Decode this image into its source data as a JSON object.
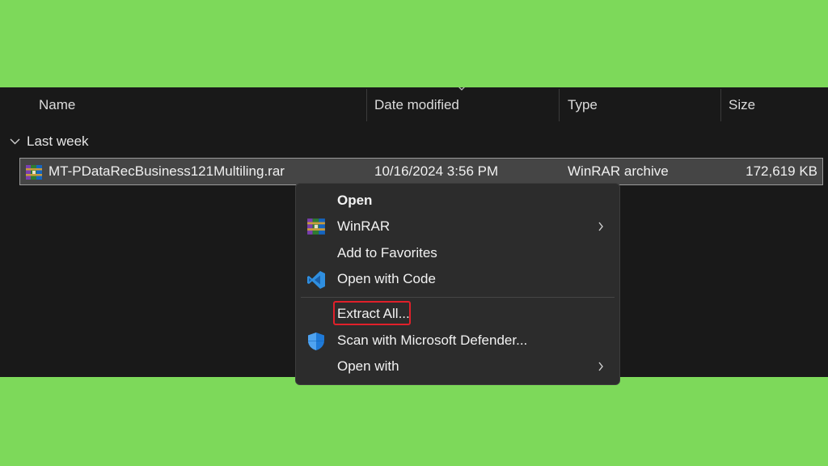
{
  "columns": {
    "name": "Name",
    "date_modified": "Date modified",
    "type": "Type",
    "size": "Size"
  },
  "group": {
    "label": "Last week",
    "icon": "chevron-down-icon"
  },
  "file": {
    "name": "MT-PDataRecBusiness121Multiling.rar",
    "date_modified": "10/16/2024 3:56 PM",
    "type": "WinRAR archive",
    "size": "172,619 KB",
    "icon": "winrar-icon"
  },
  "context_menu": {
    "items": [
      {
        "label": "Open"
      },
      {
        "label": "WinRAR",
        "icon": "winrar-icon",
        "submenu": true
      },
      {
        "label": "Add to Favorites"
      },
      {
        "label": "Open with Code",
        "icon": "vscode-icon"
      },
      {
        "label": "Extract All...",
        "highlighted": true
      },
      {
        "label": "Scan with Microsoft Defender...",
        "icon": "defender-shield-icon"
      },
      {
        "label": "Open with",
        "submenu": true
      }
    ]
  },
  "colors": {
    "background": "#7dd95a",
    "explorer": "#191919",
    "menu": "#2c2c2c",
    "highlight": "#e0202a",
    "vscode": "#2f8fe0",
    "defender": "#1f7ad8"
  }
}
